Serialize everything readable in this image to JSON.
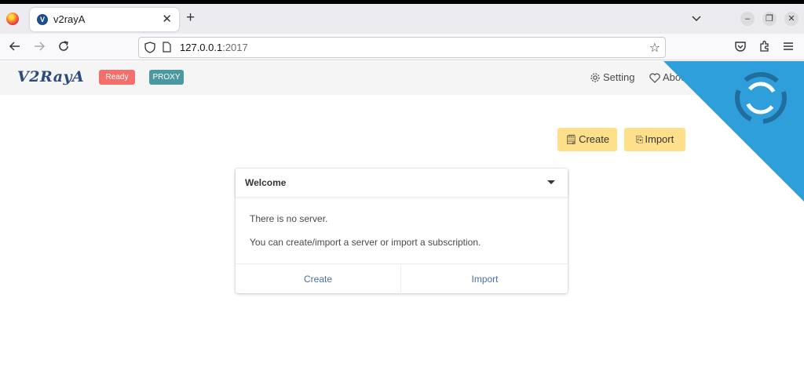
{
  "browser": {
    "tab": {
      "favicon": "V",
      "title": "v2rayA",
      "close": "✕"
    },
    "new_tab": "+",
    "window_controls": {
      "minimize": "–",
      "restore": "❐",
      "close": "✕"
    },
    "url": {
      "host": "127.0.0.1",
      "port": ":2017"
    },
    "bookmark_star": "☆"
  },
  "header": {
    "logo": "V2RayA",
    "badges": {
      "ready": "Ready",
      "proxy": "PROXY"
    },
    "links": {
      "setting": "Setting",
      "about": "About"
    }
  },
  "toolbar": {
    "create_label": "Create",
    "import_label": "Import"
  },
  "welcome": {
    "title": "Welcome",
    "line1": "There is no server.",
    "line2": "You can create/import a server or import a subscription.",
    "footer_create": "Create",
    "footer_import": "Import"
  },
  "colors": {
    "ready": "#f26f6a",
    "proxy": "#4a98a0",
    "accent_button": "#ffe08a",
    "ribbon": "#2f9fdb",
    "link": "#4a6da7"
  }
}
